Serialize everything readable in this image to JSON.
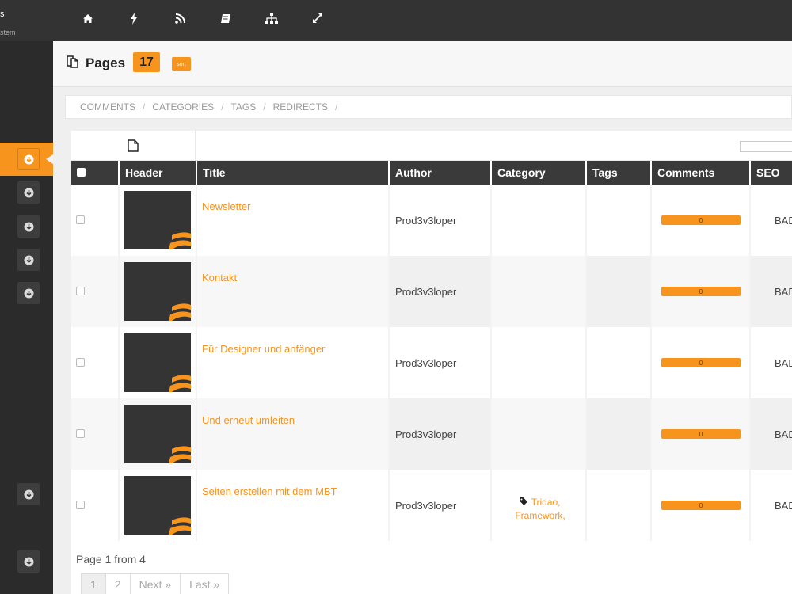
{
  "brand": {
    "line1": "s",
    "line2": "stem"
  },
  "topnav": [
    "home-icon",
    "bolt-icon",
    "rss-icon",
    "book-icon",
    "sitemap-icon",
    "expand-icon"
  ],
  "header": {
    "title": "Pages",
    "count": "17",
    "sort_label": "sort"
  },
  "breadcrumbs": [
    "COMMENTS",
    "CATEGORIES",
    "TAGS",
    "REDIRECTS"
  ],
  "table": {
    "columns": [
      "Header",
      "Title",
      "Author",
      "Category",
      "Tags",
      "Comments",
      "SEO"
    ],
    "rows": [
      {
        "title": "Newsletter",
        "author": "Prod3v3loper",
        "category": "",
        "category2": "",
        "comments": "0",
        "seo": "BAD"
      },
      {
        "title": "Kontakt",
        "author": "Prod3v3loper",
        "category": "",
        "category2": "",
        "comments": "0",
        "seo": "BAD"
      },
      {
        "title": "Für Designer und anfänger",
        "author": "Prod3v3loper",
        "category": "",
        "category2": "",
        "comments": "0",
        "seo": "BAD"
      },
      {
        "title": "Und erneut umleiten",
        "author": "Prod3v3loper",
        "category": "",
        "category2": "",
        "comments": "0",
        "seo": "BAD"
      },
      {
        "title": "Seiten erstellen mit dem MBT",
        "author": "Prod3v3loper",
        "category": "Tridao,",
        "category2": "Framework,",
        "comments": "0",
        "seo": "BAD"
      }
    ]
  },
  "pagination": {
    "info": "Page 1 from 4",
    "pages": [
      "1",
      "2"
    ],
    "next": "Next »",
    "last": "Last »"
  },
  "colors": {
    "accent": "#f6941d",
    "dark": "#333333"
  }
}
